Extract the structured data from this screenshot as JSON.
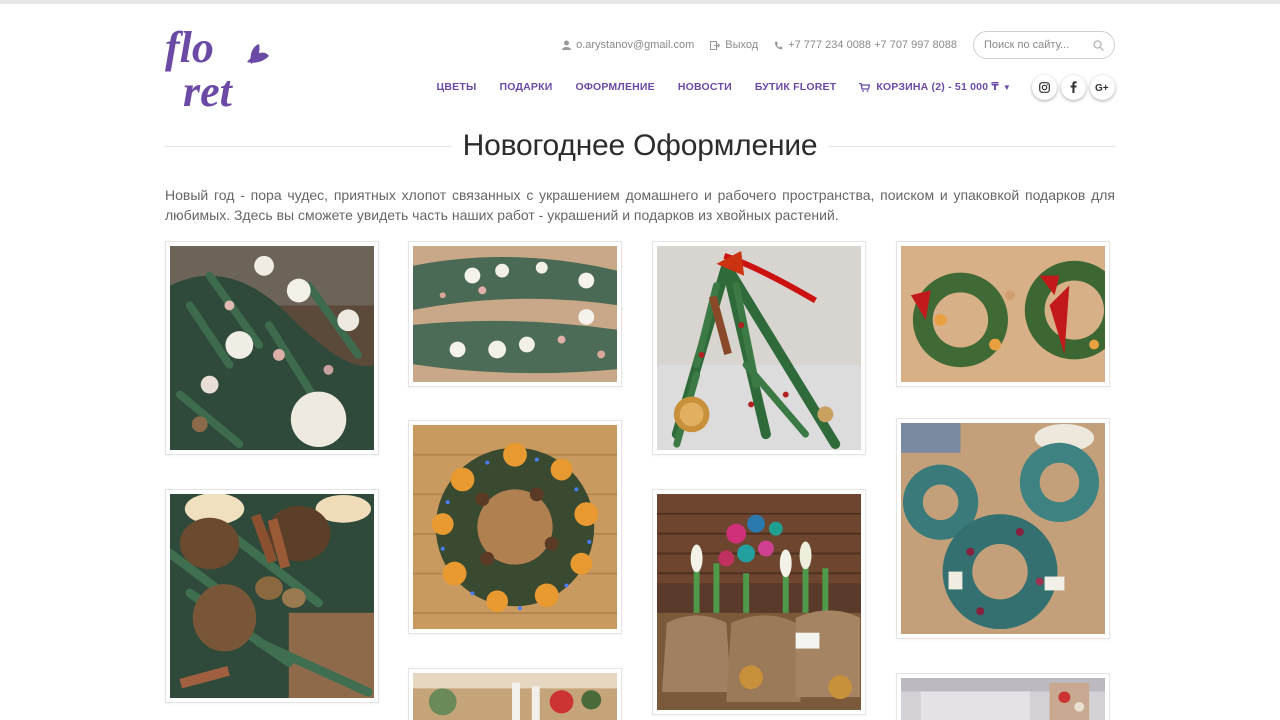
{
  "brand": {
    "logo_text": "floret",
    "color": "#6b4aa6"
  },
  "topbar": {
    "email": "o.arystanov@gmail.com",
    "logout": "Выход",
    "phones": "+7 777 234 0088 +7 707 997 8088",
    "search_placeholder": "Поиск по сайту..."
  },
  "nav": {
    "items": [
      "ЦВЕТЫ",
      "ПОДАРКИ",
      "ОФОРМЛЕНИЕ",
      "НОВОСТИ",
      "БУТИК FLORET"
    ],
    "cart": "КОРЗИНА (2) - 51 000 ₸"
  },
  "social": [
    "instagram-icon",
    "facebook-icon",
    "google-plus-icon"
  ],
  "page": {
    "title": "Новогоднее Оформление",
    "intro": "Новый год - пора чудес, приятных хлопот связанных с украшением домашнего и рабочего пространства, поиском и упаковкой подарков для любимых. Здесь вы сможете увидеть часть наших работ - украшений и подарков из хвойных растений."
  },
  "gallery": [
    {
      "name": "photo-flower-garland-table"
    },
    {
      "name": "photo-roses-garlands"
    },
    {
      "name": "photo-pine-tree-ribbon"
    },
    {
      "name": "photo-wreaths-red-ribbons"
    },
    {
      "name": "photo-citrus-wreath-lights"
    },
    {
      "name": "photo-spruce-wreaths-workshop"
    },
    {
      "name": "photo-pine-cones-cinnamon"
    },
    {
      "name": "photo-hyacinth-pots-ornaments"
    },
    {
      "name": "photo-table-decoration"
    },
    {
      "name": "photo-interior-decoration"
    }
  ]
}
